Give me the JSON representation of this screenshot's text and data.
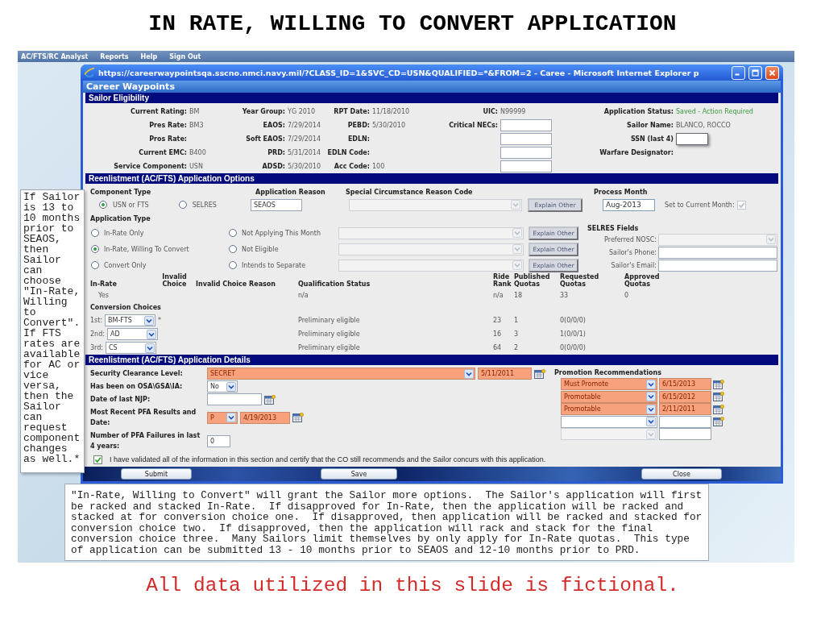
{
  "slide_title": "IN RATE, WILLING TO CONVERT APPLICATION",
  "app_menu": [
    "AC/FTS/RC Analyst",
    "Reports",
    "Help",
    "Sign Out"
  ],
  "window": {
    "title": "https://careerwaypointsqa.sscno.nmci.navy.mil/?CLASS_ID=1&SVC_CD=USN&QUALIFIED=*&FROM=2 - Caree - Microsoft Internet Explorer p",
    "app_header": "Career Waypoints"
  },
  "eligibility": {
    "heading": "Sailor Eligibility",
    "rows": [
      [
        {
          "kind": "text",
          "label": "Current Rating:",
          "value": "BM"
        },
        {
          "kind": "text",
          "label": "Year Group:",
          "value": "YG 2010"
        },
        {
          "kind": "text",
          "label": "RPT Date:",
          "value": "11/18/2010"
        },
        {
          "kind": "text",
          "label": "UIC:",
          "value": "N99999"
        },
        {
          "kind": "status",
          "label": "Application Status:",
          "value": "Saved - Action Required"
        }
      ],
      [
        {
          "kind": "text",
          "label": "Pres Rate:",
          "value": "BM3"
        },
        {
          "kind": "text",
          "label": "EAOS:",
          "value": "7/29/2014"
        },
        {
          "kind": "text",
          "label": "PEBD:",
          "value": "5/30/2010"
        },
        {
          "kind": "input",
          "label": "Critical NECs:"
        },
        {
          "kind": "text",
          "label": "Sailor Name:",
          "value": "BLANCO, ROCCO"
        }
      ],
      [
        {
          "kind": "text",
          "label": "Pros Rate:"
        },
        {
          "kind": "text",
          "label": "Soft EAOS:",
          "value": "7/29/2014"
        },
        {
          "kind": "text",
          "label": "EDLN:"
        },
        {
          "kind": "input"
        },
        {
          "kind": "input",
          "label": "SSN (last 4)"
        }
      ],
      [
        {
          "kind": "text",
          "label": "Current EMC:",
          "value": "B400"
        },
        {
          "kind": "text",
          "label": "PRD:",
          "value": "5/31/2014"
        },
        {
          "kind": "text",
          "label": "EDLN Code:"
        },
        {
          "kind": "input"
        },
        {
          "kind": "text",
          "label": "Warfare Designator:"
        }
      ],
      [
        {
          "kind": "text",
          "label": "Service Component:",
          "value": "USN"
        },
        {
          "kind": "text",
          "label": "ADSD:",
          "value": "5/30/2010"
        },
        {
          "kind": "text",
          "label": "Acc Code:",
          "value": "100"
        },
        {
          "kind": "input"
        },
        {
          "kind": "blank"
        }
      ]
    ]
  },
  "options": {
    "heading": "Reenlistment (AC/FTS) Application Options",
    "component_type": {
      "label": "Component Type",
      "choices": [
        {
          "label": "USN or FTS",
          "selected": true
        },
        {
          "label": "SELRES",
          "selected": false
        }
      ]
    },
    "application_reason": {
      "label": "Application Reason",
      "value": "SEAOS"
    },
    "special_circumstance": {
      "label": "Special Circumstance Reason Code",
      "button": "Explain Other",
      "disabled": true
    },
    "process_month": {
      "label": "Process Month",
      "value": "Aug-2013"
    },
    "set_current_month": {
      "label": "Set to Current Month:",
      "checked": true,
      "disabled": true
    },
    "application_type": {
      "label": "Application Type",
      "rows": [
        {
          "left": {
            "label": "In-Rate Only",
            "selected": false
          },
          "right": {
            "label": "Not Applying This Month",
            "selected": false
          },
          "button": "Explain Other",
          "disabled": true
        },
        {
          "left": {
            "label": "In-Rate, Willing To Convert",
            "selected": true
          },
          "right": {
            "label": "Not Eligible",
            "selected": false
          },
          "button": "Explain Other",
          "disabled": true
        },
        {
          "left": {
            "label": "Convert Only",
            "selected": false
          },
          "right": {
            "label": "Intends to Separate",
            "selected": false
          },
          "button": "Explain Other",
          "disabled": true
        }
      ]
    },
    "selres": {
      "heading": "SELRES Fields",
      "fields": [
        {
          "kind": "select",
          "label": "Preferred NOSC:"
        },
        {
          "kind": "input",
          "label": "Sailor's Phone:"
        },
        {
          "kind": "input",
          "label": "Sailor's Email:"
        }
      ]
    },
    "choices_table": {
      "columns": [
        "In-Rate",
        "Invalid Choice",
        "Invalid Choice Reason",
        "Qualification Status",
        "Ride Rank",
        "Published Quotas",
        "Requested Quotas",
        "Approved Quotas"
      ],
      "in_rate_row": {
        "in_rate": "Yes",
        "qualification_status": "n/a",
        "ride_rank": "n/a",
        "published_quotas": "18",
        "requested_quotas": "33",
        "approved_quotas": "0"
      },
      "conversion_heading": "Conversion Choices",
      "conversion_rows": [
        {
          "ordinal": "1st:",
          "choice": "BM-FTS",
          "marker": "*",
          "qualification_status": "Preliminary eligible",
          "ride_rank": "23",
          "published_quotas": "1",
          "requested_quotas": "0(0/0/0)"
        },
        {
          "ordinal": "2nd:",
          "choice": "AD",
          "qualification_status": "Preliminary eligible",
          "ride_rank": "16",
          "published_quotas": "3",
          "requested_quotas": "1(0/0/1)"
        },
        {
          "ordinal": "3rd:",
          "choice": "CS",
          "qualification_status": "Preliminary eligible",
          "ride_rank": "64",
          "published_quotas": "2",
          "requested_quotas": "0(0/0/0)"
        }
      ]
    }
  },
  "details": {
    "heading": "Reenlistment (AC/FTS) Application Details",
    "fields": [
      {
        "kind": "longselect",
        "label": "Security Clearance Level:",
        "value": "SECRET",
        "date": "5/11/2011",
        "highlighted": true
      },
      {
        "kind": "select",
        "label": "Has been on OSA\\GSA\\IA:",
        "value": "No",
        "highlighted": false
      },
      {
        "kind": "date",
        "label": "Date of last NJP:"
      },
      {
        "kind": "select",
        "label": "Most Recent PFA Results and Date:",
        "value": "P",
        "date": "4/19/2013",
        "highlighted": true
      },
      {
        "kind": "number",
        "label": "Number of PFA Failures in last 4 years:",
        "value": "0"
      }
    ],
    "promotions": {
      "heading": "Promotion Recommendations",
      "rows": [
        {
          "kind": "filled",
          "value": "Must Promote",
          "date": "6/15/2013"
        },
        {
          "kind": "filled",
          "value": "Promotable",
          "date": "6/15/2012"
        },
        {
          "kind": "filled",
          "value": "Promotable",
          "date": "2/11/2011"
        },
        {
          "kind": "empty"
        },
        {
          "kind": "disabled"
        }
      ]
    },
    "certify": {
      "label": "I have validated all of the information in this section and certify that the CO still recommends and the Sailor concurs with this application.",
      "checked": true
    }
  },
  "buttons": [
    "Submit",
    "Save",
    "Close"
  ],
  "callouts": {
    "side": "If Sailor is 13 to 10 months prior to SEAOS, then Sailor can choose \"In-Rate, Willing to Convert\". If FTS rates are available for AC or vice versa, then the Sailor can request component changes as well.*",
    "bottom": "\"In-Rate, Willing to Convert\" will grant the Sailor more options.  The Sailor's application will first be racked and stacked In-Rate.  If disapproved for In-Rate, then the application will be racked and stacked at for conversion choice one.  If disapproved, then application will be racked and stacked for conversion choice two.  If disapproved, then the application will rack and stack for the final conversion choice three.  Many Sailors limit themselves by only apply for In-Rate quotas.  This type of application can be submitted 13 - 10 months prior to SEAOS and 12-10 months prior to PRD."
  },
  "disclaimer": "All data utilized in this slide is fictional."
}
